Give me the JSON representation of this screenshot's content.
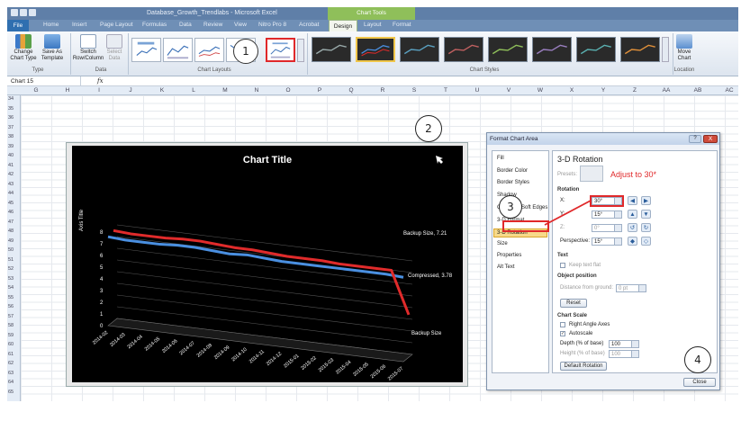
{
  "window": {
    "title": "Database_Growth_Trendlabs - Microsoft Excel",
    "chart_tools_label": "Chart Tools"
  },
  "tabs": [
    "File",
    "Home",
    "Insert",
    "Page Layout",
    "Formulas",
    "Data",
    "Review",
    "View",
    "Nitro Pro 8",
    "Acrobat",
    "Design",
    "Layout",
    "Format"
  ],
  "ribbon": {
    "change_chart_type": "Change Chart Type",
    "save_as_template": "Save As Template",
    "type_group": "Type",
    "switch_row_column": "Switch Row/Column",
    "select_data": "Select Data",
    "data_group": "Data",
    "chart_layouts_group": "Chart Layouts",
    "chart_styles_group": "Chart Styles",
    "move_chart": "Move Chart",
    "location_group": "Location"
  },
  "formula_bar": {
    "name_box": "Chart 15",
    "fx": "fx"
  },
  "columns": [
    "G",
    "H",
    "I",
    "J",
    "K",
    "L",
    "M",
    "N",
    "O",
    "P",
    "Q",
    "R",
    "S",
    "T",
    "U",
    "V",
    "W",
    "X",
    "Y",
    "Z",
    "AA",
    "AB",
    "AC"
  ],
  "rows": [
    "34",
    "35",
    "36",
    "37",
    "38",
    "39",
    "40",
    "41",
    "42",
    "43",
    "44",
    "45",
    "46",
    "47",
    "48",
    "49",
    "50",
    "51",
    "52",
    "53",
    "54",
    "55",
    "56",
    "57",
    "58",
    "59",
    "60",
    "61",
    "62",
    "63",
    "64",
    "65"
  ],
  "chart": {
    "title": "Chart Title",
    "axis_title": "Axis Title",
    "y_ticks": [
      "0",
      "1",
      "2",
      "3",
      "4",
      "5",
      "6",
      "7",
      "8"
    ],
    "x_labels": [
      "2014-02",
      "2014-03",
      "2014-04",
      "2014-05",
      "2014-06",
      "2014-07",
      "2014-08",
      "2014-09",
      "2014-10",
      "2014-11",
      "2014-12",
      "2015-01",
      "2015-02",
      "2015-03",
      "2015-04",
      "2015-05",
      "2015-06",
      "2015-07"
    ],
    "label_backup": "Backup Size, 7.21",
    "label_compressed": "Compressed, 3.78",
    "depth_label": "Backup Size"
  },
  "chart_data": {
    "type": "line",
    "title": "Chart Title",
    "ylabel": "Axis Title",
    "ylim": [
      0,
      8
    ],
    "x": [
      "2014-02",
      "2014-03",
      "2014-04",
      "2014-05",
      "2014-06",
      "2014-07",
      "2014-08",
      "2014-09",
      "2014-10",
      "2014-11",
      "2014-12",
      "2015-01",
      "2015-02",
      "2015-03",
      "2015-04",
      "2015-05",
      "2015-06",
      "2015-07"
    ],
    "series": [
      {
        "name": "Backup Size",
        "color": "#4a8fe0",
        "values": [
          7.6,
          7.5,
          7.5,
          7.5,
          7.6,
          7.6,
          7.5,
          7.4,
          7.5,
          7.4,
          7.3,
          7.3,
          7.3,
          7.3,
          7.3,
          7.3,
          7.3,
          7.21
        ]
      },
      {
        "name": "Compressed",
        "color": "#e02b2b",
        "values": [
          7.9,
          7.8,
          7.8,
          7.8,
          7.9,
          7.9,
          7.8,
          7.7,
          7.7,
          7.6,
          7.5,
          7.5,
          7.5,
          7.4,
          7.4,
          7.4,
          7.4,
          3.78
        ]
      }
    ]
  },
  "dialog": {
    "title": "Format Chart Area",
    "help": "?",
    "close_x": "X",
    "nav": [
      "Fill",
      "Border Color",
      "Border Styles",
      "Shadow",
      "Glow and Soft Edges",
      "3-D Format",
      "3-D Rotation",
      "Size",
      "Properties",
      "Alt Text"
    ],
    "section_title": "3-D Rotation",
    "presets_label": "Presets:",
    "rotation_label": "Rotation",
    "x_label": "X:",
    "x_value": "30°",
    "y_label": "Y:",
    "y_value": "15°",
    "z_label": "Z:",
    "z_value": "0°",
    "perspective_label": "Perspective:",
    "perspective_value": "15°",
    "text_label": "Text",
    "keep_text_flat": "Keep text flat",
    "object_position": "Object position",
    "distance_label": "Distance from ground:",
    "distance_value": "0 pt",
    "reset": "Reset",
    "chart_scale": "Chart Scale",
    "right_angle_axes": "Right Angle Axes",
    "autoscale": "Autoscale",
    "depth_label": "Depth (% of base)",
    "depth_value": "100",
    "height_label": "Height (% of base)",
    "height_value": "100",
    "default_rotation": "Default Rotation",
    "close": "Close"
  },
  "annotations": {
    "c1": "1",
    "c2": "2",
    "c3": "3",
    "c4": "4",
    "adjust_note": "Adjust to 30*"
  },
  "colors": {
    "accent_red": "#e0282a",
    "ribbon_blue": "#6f8fb6",
    "chart_tools_green": "#8fbf5a",
    "highlight": "#f7d98a"
  }
}
